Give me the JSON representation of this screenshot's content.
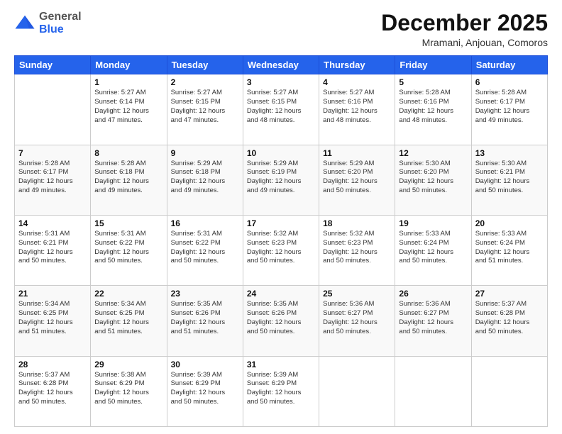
{
  "header": {
    "logo_general": "General",
    "logo_blue": "Blue",
    "month_year": "December 2025",
    "location": "Mramani, Anjouan, Comoros"
  },
  "days_of_week": [
    "Sunday",
    "Monday",
    "Tuesday",
    "Wednesday",
    "Thursday",
    "Friday",
    "Saturday"
  ],
  "weeks": [
    [
      {
        "day": "",
        "info": ""
      },
      {
        "day": "1",
        "info": "Sunrise: 5:27 AM\nSunset: 6:14 PM\nDaylight: 12 hours\nand 47 minutes."
      },
      {
        "day": "2",
        "info": "Sunrise: 5:27 AM\nSunset: 6:15 PM\nDaylight: 12 hours\nand 47 minutes."
      },
      {
        "day": "3",
        "info": "Sunrise: 5:27 AM\nSunset: 6:15 PM\nDaylight: 12 hours\nand 48 minutes."
      },
      {
        "day": "4",
        "info": "Sunrise: 5:27 AM\nSunset: 6:16 PM\nDaylight: 12 hours\nand 48 minutes."
      },
      {
        "day": "5",
        "info": "Sunrise: 5:28 AM\nSunset: 6:16 PM\nDaylight: 12 hours\nand 48 minutes."
      },
      {
        "day": "6",
        "info": "Sunrise: 5:28 AM\nSunset: 6:17 PM\nDaylight: 12 hours\nand 49 minutes."
      }
    ],
    [
      {
        "day": "7",
        "info": "Sunrise: 5:28 AM\nSunset: 6:17 PM\nDaylight: 12 hours\nand 49 minutes."
      },
      {
        "day": "8",
        "info": "Sunrise: 5:28 AM\nSunset: 6:18 PM\nDaylight: 12 hours\nand 49 minutes."
      },
      {
        "day": "9",
        "info": "Sunrise: 5:29 AM\nSunset: 6:18 PM\nDaylight: 12 hours\nand 49 minutes."
      },
      {
        "day": "10",
        "info": "Sunrise: 5:29 AM\nSunset: 6:19 PM\nDaylight: 12 hours\nand 49 minutes."
      },
      {
        "day": "11",
        "info": "Sunrise: 5:29 AM\nSunset: 6:20 PM\nDaylight: 12 hours\nand 50 minutes."
      },
      {
        "day": "12",
        "info": "Sunrise: 5:30 AM\nSunset: 6:20 PM\nDaylight: 12 hours\nand 50 minutes."
      },
      {
        "day": "13",
        "info": "Sunrise: 5:30 AM\nSunset: 6:21 PM\nDaylight: 12 hours\nand 50 minutes."
      }
    ],
    [
      {
        "day": "14",
        "info": "Sunrise: 5:31 AM\nSunset: 6:21 PM\nDaylight: 12 hours\nand 50 minutes."
      },
      {
        "day": "15",
        "info": "Sunrise: 5:31 AM\nSunset: 6:22 PM\nDaylight: 12 hours\nand 50 minutes."
      },
      {
        "day": "16",
        "info": "Sunrise: 5:31 AM\nSunset: 6:22 PM\nDaylight: 12 hours\nand 50 minutes."
      },
      {
        "day": "17",
        "info": "Sunrise: 5:32 AM\nSunset: 6:23 PM\nDaylight: 12 hours\nand 50 minutes."
      },
      {
        "day": "18",
        "info": "Sunrise: 5:32 AM\nSunset: 6:23 PM\nDaylight: 12 hours\nand 50 minutes."
      },
      {
        "day": "19",
        "info": "Sunrise: 5:33 AM\nSunset: 6:24 PM\nDaylight: 12 hours\nand 50 minutes."
      },
      {
        "day": "20",
        "info": "Sunrise: 5:33 AM\nSunset: 6:24 PM\nDaylight: 12 hours\nand 51 minutes."
      }
    ],
    [
      {
        "day": "21",
        "info": "Sunrise: 5:34 AM\nSunset: 6:25 PM\nDaylight: 12 hours\nand 51 minutes."
      },
      {
        "day": "22",
        "info": "Sunrise: 5:34 AM\nSunset: 6:25 PM\nDaylight: 12 hours\nand 51 minutes."
      },
      {
        "day": "23",
        "info": "Sunrise: 5:35 AM\nSunset: 6:26 PM\nDaylight: 12 hours\nand 51 minutes."
      },
      {
        "day": "24",
        "info": "Sunrise: 5:35 AM\nSunset: 6:26 PM\nDaylight: 12 hours\nand 50 minutes."
      },
      {
        "day": "25",
        "info": "Sunrise: 5:36 AM\nSunset: 6:27 PM\nDaylight: 12 hours\nand 50 minutes."
      },
      {
        "day": "26",
        "info": "Sunrise: 5:36 AM\nSunset: 6:27 PM\nDaylight: 12 hours\nand 50 minutes."
      },
      {
        "day": "27",
        "info": "Sunrise: 5:37 AM\nSunset: 6:28 PM\nDaylight: 12 hours\nand 50 minutes."
      }
    ],
    [
      {
        "day": "28",
        "info": "Sunrise: 5:37 AM\nSunset: 6:28 PM\nDaylight: 12 hours\nand 50 minutes."
      },
      {
        "day": "29",
        "info": "Sunrise: 5:38 AM\nSunset: 6:29 PM\nDaylight: 12 hours\nand 50 minutes."
      },
      {
        "day": "30",
        "info": "Sunrise: 5:39 AM\nSunset: 6:29 PM\nDaylight: 12 hours\nand 50 minutes."
      },
      {
        "day": "31",
        "info": "Sunrise: 5:39 AM\nSunset: 6:29 PM\nDaylight: 12 hours\nand 50 minutes."
      },
      {
        "day": "",
        "info": ""
      },
      {
        "day": "",
        "info": ""
      },
      {
        "day": "",
        "info": ""
      }
    ]
  ]
}
